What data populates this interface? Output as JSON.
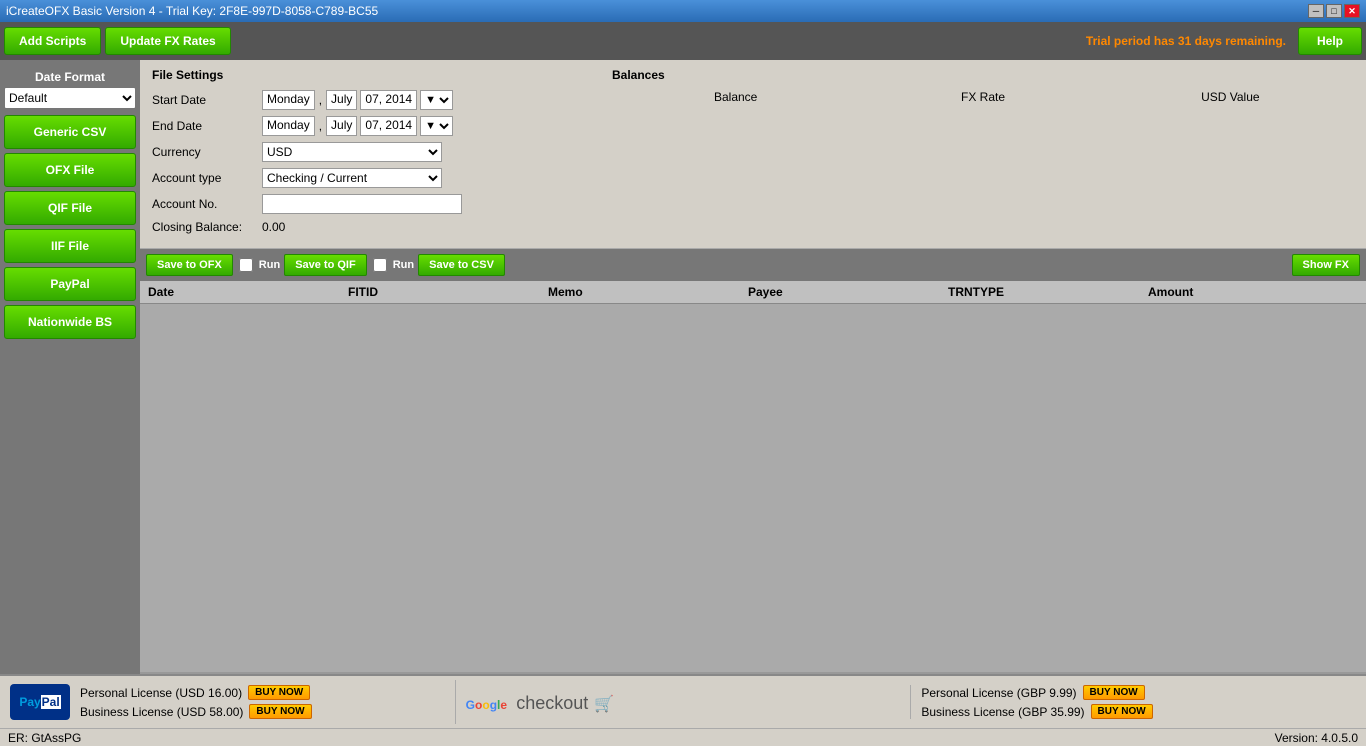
{
  "titlebar": {
    "title": "iCreateOFX Basic Version 4 - Trial Key: 2F8E-997D-8058-C789-BC55",
    "minimize": "─",
    "maximize": "□",
    "close": "✕"
  },
  "toolbar": {
    "add_scripts": "Add Scripts",
    "update_fx": "Update FX Rates",
    "trial_text": "Trial period has 31 days remaining.",
    "help": "Help"
  },
  "sidebar": {
    "date_format_label": "Date Format",
    "date_format_default": "Default",
    "generic_csv": "Generic CSV",
    "ofx_file": "OFX File",
    "qif_file": "QIF File",
    "iif_file": "IIF File",
    "paypal": "PayPal",
    "nationwide_bs": "Nationwide BS"
  },
  "file_settings": {
    "title": "File Settings",
    "start_date_label": "Start Date",
    "start_date_day": "Monday",
    "start_date_sep": ",",
    "start_date_month": "July",
    "start_date_num": "07, 2014",
    "end_date_label": "End Date",
    "end_date_day": "Monday",
    "end_date_sep": ",",
    "end_date_month": "July",
    "end_date_num": "07, 2014",
    "currency_label": "Currency",
    "currency_value": "USD",
    "account_type_label": "Account type",
    "account_type_value": "Checking / Current",
    "account_no_label": "Account No.",
    "account_no_value": "",
    "closing_balance_label": "Closing Balance:",
    "closing_balance_value": "0.00"
  },
  "balances": {
    "title": "Balances",
    "col_balance": "Balance",
    "col_fx_rate": "FX Rate",
    "col_usd_value": "USD Value"
  },
  "action_bar": {
    "save_ofx": "Save to OFX",
    "run1": "Run",
    "save_qif": "Save to QIF",
    "run2": "Run",
    "save_csv": "Save to CSV",
    "show_fx": "Show FX"
  },
  "table": {
    "col_date": "Date",
    "col_fitid": "FITID",
    "col_memo": "Memo",
    "col_payee": "Payee",
    "col_trntype": "TRNTYPE",
    "col_amount": "Amount"
  },
  "footer": {
    "paypal_label": "PayPal",
    "personal_usd_label": "Personal License (USD 16.00)",
    "personal_usd_btn": "BUY NOW",
    "business_usd_label": "Business License (USD 58.00)",
    "business_usd_btn": "BUY NOW",
    "personal_gbp_label": "Personal License (GBP 9.99)",
    "personal_gbp_btn": "BUY NOW",
    "business_gbp_label": "Business License (GBP 35.99)",
    "business_gbp_btn": "BUY NOW"
  },
  "status_bar": {
    "left": "ER: GtAssPG",
    "right": "Version: 4.0.5.0"
  }
}
